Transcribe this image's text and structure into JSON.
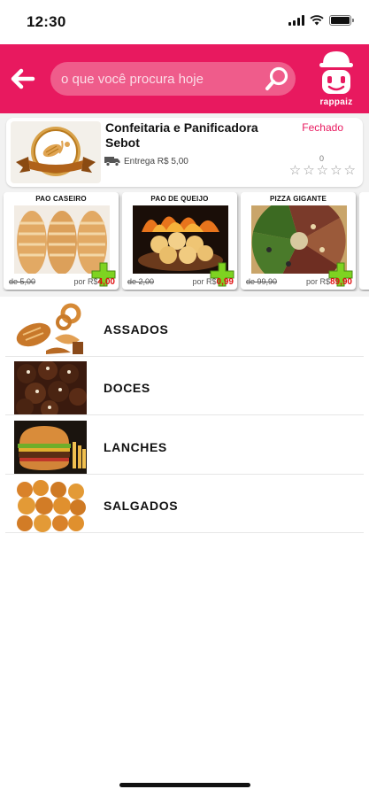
{
  "status_bar": {
    "time": "12:30"
  },
  "search": {
    "placeholder": "o que você procura hoje"
  },
  "brand": {
    "name": "rappaiz"
  },
  "store": {
    "name": "Confeitaria e Panificadora Sebot",
    "status": "Fechado",
    "delivery": "Entrega R$ 5,00",
    "rating_count": "0"
  },
  "products": [
    {
      "name": "PAO CASEIRO",
      "old_price": "de 5,00",
      "price_prefix": "por R$",
      "price": "4,00"
    },
    {
      "name": "PAO DE QUEIJO",
      "old_price": "de 2,00",
      "price_prefix": "por R$",
      "price": "0,99"
    },
    {
      "name": "PIZZA GIGANTE",
      "old_price": "de 99,90",
      "price_prefix": "por R$",
      "price": "89,90"
    }
  ],
  "categories": [
    {
      "label": "ASSADOS"
    },
    {
      "label": "DOCES"
    },
    {
      "label": "LANCHES"
    },
    {
      "label": "SALGADOS"
    }
  ],
  "colors": {
    "brand": "#e8195f",
    "price": "#e01010",
    "add": "#7ed321"
  }
}
